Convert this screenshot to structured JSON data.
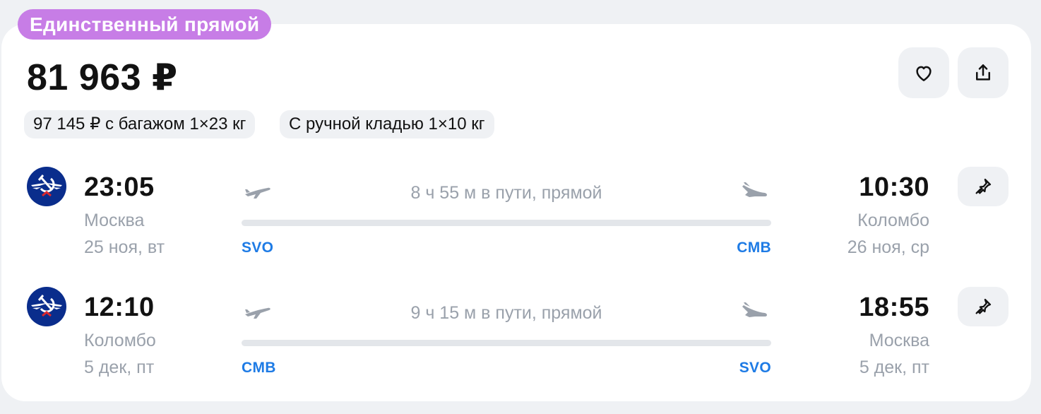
{
  "badge": "Единственный прямой",
  "price": "81 963 ₽",
  "chips": [
    "97 145 ₽ с багажом 1×23 кг",
    "С ручной кладью 1×10 кг"
  ],
  "icons": {
    "favorite": "heart-icon",
    "share": "share-icon",
    "pin": "pin-icon",
    "takeoff": "plane-takeoff-icon",
    "landing": "plane-landing-icon",
    "airline": "aeroflot-logo"
  },
  "colors": {
    "badge": "#c77de6",
    "iata": "#1e7be5",
    "muted": "#9aa1ab",
    "airline_logo": "#0a2d8c"
  },
  "segments": [
    {
      "depart_time": "23:05",
      "depart_city": "Москва",
      "depart_date": "25 ноя, вт",
      "duration": "8 ч 55 м в пути, прямой",
      "from_code": "SVO",
      "to_code": "CMB",
      "arrive_time": "10:30",
      "arrive_city": "Коломбо",
      "arrive_date": "26 ноя, ср"
    },
    {
      "depart_time": "12:10",
      "depart_city": "Коломбо",
      "depart_date": "5 дек, пт",
      "duration": "9 ч 15 м в пути, прямой",
      "from_code": "CMB",
      "to_code": "SVO",
      "arrive_time": "18:55",
      "arrive_city": "Москва",
      "arrive_date": "5 дек, пт"
    }
  ]
}
